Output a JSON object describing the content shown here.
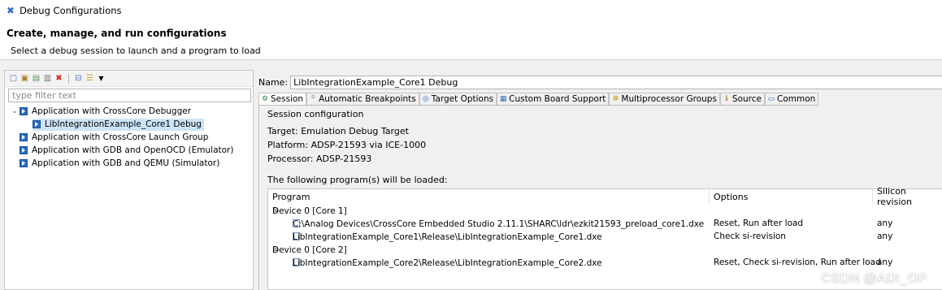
{
  "window": {
    "title": "Debug Configurations"
  },
  "header": {
    "title": "Create, manage, and run configurations",
    "subtitle": "Select a debug session to launch and a program to load"
  },
  "filter": {
    "placeholder": "type filter text"
  },
  "tree": {
    "items": [
      {
        "label": "Application with CrossCore Debugger",
        "expanded": true,
        "children": [
          {
            "label": "LibIntegrationExample_Core1 Debug",
            "selected": true
          }
        ]
      },
      {
        "label": "Application with CrossCore Launch Group"
      },
      {
        "label": "Application with GDB and OpenOCD (Emulator)"
      },
      {
        "label": "Application with GDB and QEMU (Simulator)"
      }
    ]
  },
  "name": {
    "label": "Name:",
    "value": "LibIntegrationExample_Core1 Debug"
  },
  "tabs": [
    {
      "label": "Session",
      "active": true
    },
    {
      "label": "Automatic Breakpoints"
    },
    {
      "label": "Target Options"
    },
    {
      "label": "Custom Board Support"
    },
    {
      "label": "Multiprocessor Groups"
    },
    {
      "label": "Source"
    },
    {
      "label": "Common"
    }
  ],
  "session": {
    "heading": "Session configuration",
    "target": "Target: Emulation Debug Target",
    "platform": "Platform: ADSP-21593 via ICE-1000",
    "processor": "Processor: ADSP-21593"
  },
  "programs": {
    "caption": "The following program(s) will be loaded:",
    "columns": [
      "Program",
      "Options",
      "Silicon revision"
    ],
    "rows": [
      {
        "kind": "device",
        "program": "Device 0 [Core 1]",
        "options": "",
        "silicon": ""
      },
      {
        "kind": "file",
        "program": "C:\\Analog Devices\\CrossCore Embedded Studio 2.11.1\\SHARC\\ldr\\ezkit21593_preload_core1.dxe",
        "options": "Reset, Run after load",
        "silicon": "any"
      },
      {
        "kind": "file",
        "program": "LibIntegrationExample_Core1\\Release\\LibIntegrationExample_Core1.dxe",
        "options": "Check si-revision",
        "silicon": "any"
      },
      {
        "kind": "device",
        "program": "Device 0 [Core 2]",
        "options": "",
        "silicon": ""
      },
      {
        "kind": "file",
        "program": "LibIntegrationExample_Core2\\Release\\LibIntegrationExample_Core2.dxe",
        "options": "Reset, Check si-revision, Run after load",
        "silicon": "any"
      }
    ]
  },
  "watermark": "CSDN @ADI_OP"
}
